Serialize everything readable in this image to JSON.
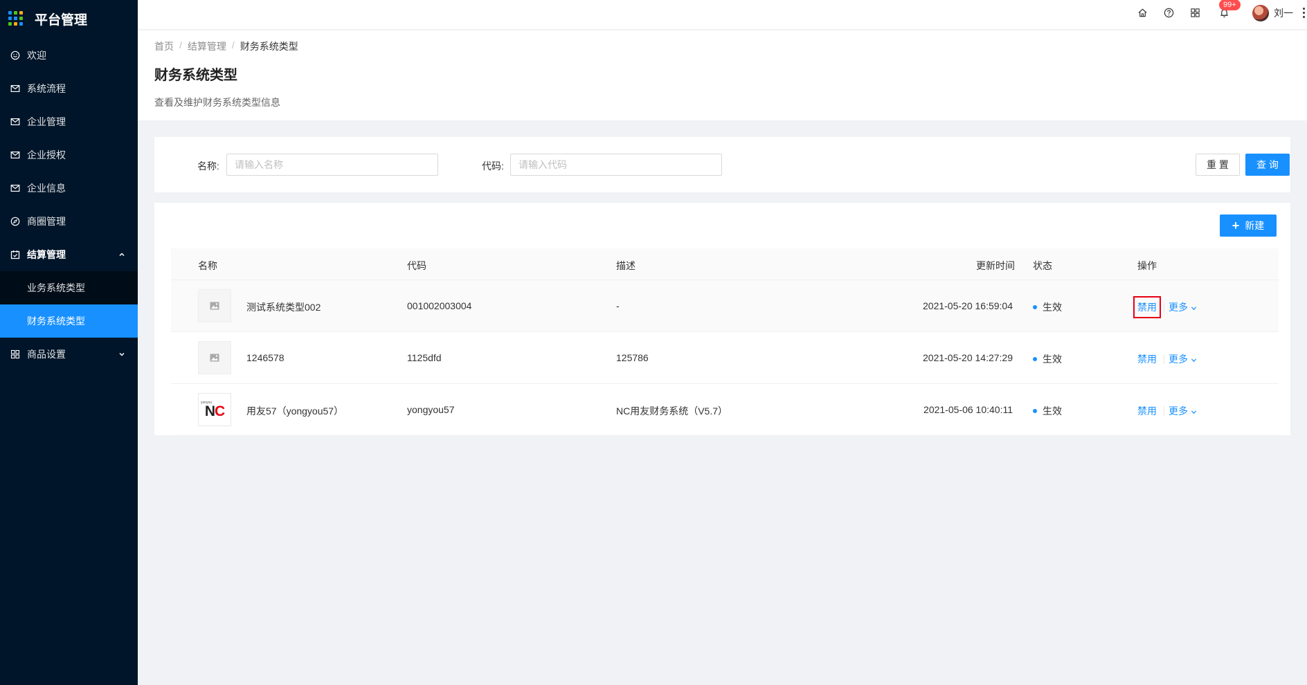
{
  "app": {
    "title": "平台管理"
  },
  "sidebar": {
    "items": [
      {
        "label": "欢迎",
        "icon": "smile-icon"
      },
      {
        "label": "系统流程",
        "icon": "mail-icon"
      },
      {
        "label": "企业管理",
        "icon": "mail-icon"
      },
      {
        "label": "企业授权",
        "icon": "mail-icon"
      },
      {
        "label": "企业信息",
        "icon": "mail-icon"
      },
      {
        "label": "商圈管理",
        "icon": "compass-icon"
      },
      {
        "label": "结算管理",
        "icon": "calendar-icon",
        "expanded": true,
        "children": [
          {
            "label": "业务系统类型"
          },
          {
            "label": "财务系统类型",
            "active": true
          }
        ]
      },
      {
        "label": "商品设置",
        "icon": "appstore-icon",
        "expanded": false
      }
    ]
  },
  "header": {
    "notification_badge": "99+",
    "username": "刘一",
    "icons": [
      "home-icon",
      "question-icon",
      "appstore-icon",
      "bell-icon"
    ]
  },
  "breadcrumb": [
    "首页",
    "结算管理",
    "财务系统类型"
  ],
  "page": {
    "title": "财务系统类型",
    "description": "查看及维护财务系统类型信息"
  },
  "search": {
    "name_label": "名称:",
    "name_placeholder": "请输入名称",
    "code_label": "代码:",
    "code_placeholder": "请输入代码",
    "reset_label": "重 置",
    "query_label": "查 询"
  },
  "table": {
    "new_label": "新建",
    "columns": [
      "名称",
      "代码",
      "描述",
      "更新时间",
      "状态",
      "操作"
    ],
    "rows": [
      {
        "name": "测试系统类型002",
        "code": "001002003004",
        "desc": "-",
        "updated": "2021-05-20 16:59:04",
        "status": "生效",
        "logo": "placeholder",
        "action": "禁用",
        "more": "更多"
      },
      {
        "name": "1246578",
        "code": "1125dfd",
        "desc": "125786",
        "updated": "2021-05-20 14:27:29",
        "status": "生效",
        "logo": "placeholder",
        "action": "禁用",
        "more": "更多"
      },
      {
        "name": "用友57（yongyou57）",
        "code": "yongyou57",
        "desc": "NC用友财务系统（V5.7）",
        "updated": "2021-05-06 10:40:11",
        "status": "生效",
        "logo": "nc-logo",
        "action": "禁用",
        "more": "更多"
      }
    ]
  },
  "logo_text": {
    "brand_small": "yonyou",
    "brand_n": "N",
    "brand_c": "C"
  },
  "colors": {
    "sidebar_bg": "#001529",
    "primary": "#1890ff",
    "highlight_box": "#e60012",
    "badge": "#ff4d4f"
  }
}
